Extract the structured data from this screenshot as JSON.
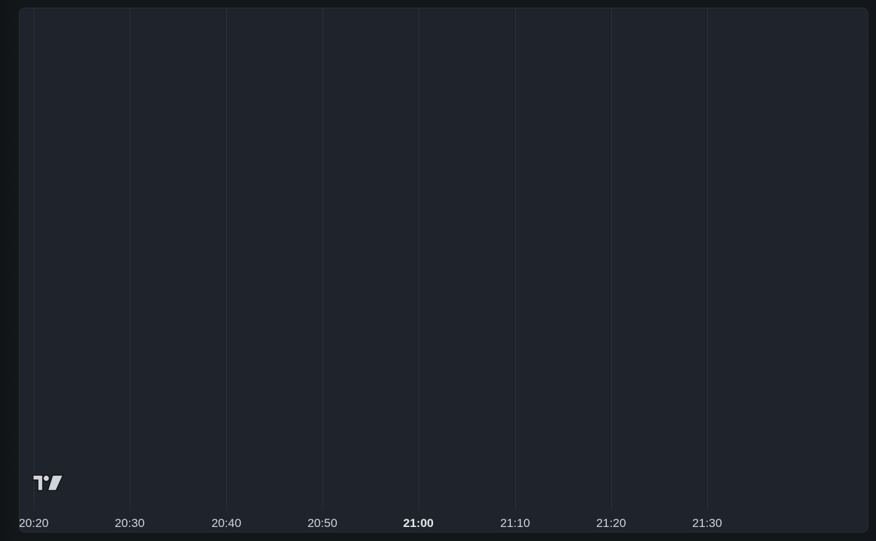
{
  "chart_data": {
    "type": "line",
    "x_axis": {
      "type": "time",
      "ticks": [
        "20:20",
        "20:30",
        "20:40",
        "20:50",
        "21:00",
        "21:10",
        "21:20",
        "21:30"
      ],
      "emphasized_tick": "21:00"
    },
    "series": [],
    "grid": {
      "vertical": true,
      "horizontal": false
    },
    "legend": "none"
  },
  "branding": {
    "logo_icon": "tradingview-logo-icon"
  },
  "colors": {
    "panel_background": "#1f232b",
    "page_background": "#14171a",
    "grid_line": "#2b2f37",
    "tick_text": "#d1d4dc",
    "logo": "#d1d4dc"
  }
}
